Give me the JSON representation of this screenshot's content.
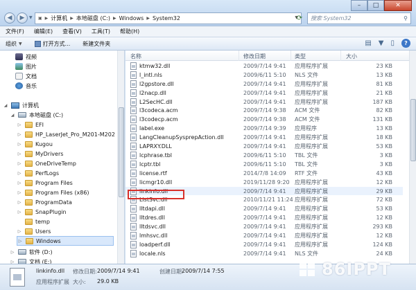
{
  "address": {
    "crumbs": [
      "计算机",
      "本地磁盘 (C:)",
      "Windows",
      "System32"
    ]
  },
  "search": {
    "placeholder": "搜索 System32"
  },
  "menu": [
    "文件(F)",
    "编辑(E)",
    "查看(V)",
    "工具(T)",
    "帮助(H)"
  ],
  "toolbar": {
    "organize": "组织",
    "open_with": "打开方式...",
    "new_folder": "新建文件夹"
  },
  "nav": {
    "libraries": [
      "视频",
      "图片",
      "文档",
      "音乐"
    ],
    "computer": "计算机",
    "drive_c": "本地磁盘 (C:)",
    "folders": [
      "EFI",
      "HP_LaserJet_Pro_M201-M202",
      "Kugou",
      "MyDrivers",
      "OneDriveTemp",
      "PerfLogs",
      "Program Files",
      "Program Files (x86)",
      "ProgramData",
      "SnapPlugin",
      "temp",
      "Users",
      "Windows"
    ],
    "drive_d": "软件 (D:)",
    "drive_e": "文档 (E:)"
  },
  "columns": {
    "name": "名称",
    "date": "修改日期",
    "type": "类型",
    "size": "大小"
  },
  "files": [
    {
      "name": "ktmw32.dll",
      "date": "2009/7/14 9:41",
      "type": "应用程序扩展",
      "size": "23 KB"
    },
    {
      "name": "l_intl.nls",
      "date": "2009/6/11 5:10",
      "type": "NLS 文件",
      "size": "13 KB"
    },
    {
      "name": "l2gpstore.dll",
      "date": "2009/7/14 9:41",
      "type": "应用程序扩展",
      "size": "81 KB"
    },
    {
      "name": "l2nacp.dll",
      "date": "2009/7/14 9:41",
      "type": "应用程序扩展",
      "size": "21 KB"
    },
    {
      "name": "L2SecHC.dll",
      "date": "2009/7/14 9:41",
      "type": "应用程序扩展",
      "size": "187 KB"
    },
    {
      "name": "l3codeca.acm",
      "date": "2009/7/14 9:38",
      "type": "ACM 文件",
      "size": "82 KB"
    },
    {
      "name": "l3codecp.acm",
      "date": "2009/7/14 9:38",
      "type": "ACM 文件",
      "size": "131 KB"
    },
    {
      "name": "label.exe",
      "date": "2009/7/14 9:39",
      "type": "应用程序",
      "size": "13 KB"
    },
    {
      "name": "LangCleanupSysprepAction.dll",
      "date": "2009/7/14 9:41",
      "type": "应用程序扩展",
      "size": "18 KB"
    },
    {
      "name": "LAPRXY.DLL",
      "date": "2009/7/14 9:41",
      "type": "应用程序扩展",
      "size": "53 KB"
    },
    {
      "name": "lcphrase.tbl",
      "date": "2009/6/11 5:10",
      "type": "TBL 文件",
      "size": "3 KB"
    },
    {
      "name": "lcptr.tbl",
      "date": "2009/6/11 5:10",
      "type": "TBL 文件",
      "size": "3 KB"
    },
    {
      "name": "license.rtf",
      "date": "2014/7/8 14:09",
      "type": "RTF 文件",
      "size": "43 KB"
    },
    {
      "name": "licmgr10.dll",
      "date": "2019/11/28 9:20",
      "type": "应用程序扩展",
      "size": "12 KB"
    },
    {
      "name": "linkinfo.dll",
      "date": "2009/7/14 9:41",
      "type": "应用程序扩展",
      "size": "29 KB"
    },
    {
      "name": "ListSvc.dll",
      "date": "2010/11/21 11:24",
      "type": "应用程序扩展",
      "size": "72 KB"
    },
    {
      "name": "lltdapi.dll",
      "date": "2009/7/14 9:41",
      "type": "应用程序扩展",
      "size": "53 KB"
    },
    {
      "name": "lltdres.dll",
      "date": "2009/7/14 9:41",
      "type": "应用程序扩展",
      "size": "12 KB"
    },
    {
      "name": "lltdsvc.dll",
      "date": "2009/7/14 9:41",
      "type": "应用程序扩展",
      "size": "293 KB"
    },
    {
      "name": "lmhsvc.dll",
      "date": "2009/7/14 9:41",
      "type": "应用程序扩展",
      "size": "12 KB"
    },
    {
      "name": "loadperf.dll",
      "date": "2009/7/14 9:41",
      "type": "应用程序扩展",
      "size": "124 KB"
    },
    {
      "name": "locale.nls",
      "date": "2009/7/14 9:41",
      "type": "NLS 文件",
      "size": "24 KB"
    }
  ],
  "details": {
    "name": "linkinfo.dll",
    "type": "应用程序扩展",
    "modified_label": "修改日期:",
    "modified": "2009/7/14 9:41",
    "size_label": "大小:",
    "size": "29.0 KB",
    "created_label": "创建日期:",
    "created": "2009/7/14 7:55"
  },
  "watermark": "86IPPT"
}
